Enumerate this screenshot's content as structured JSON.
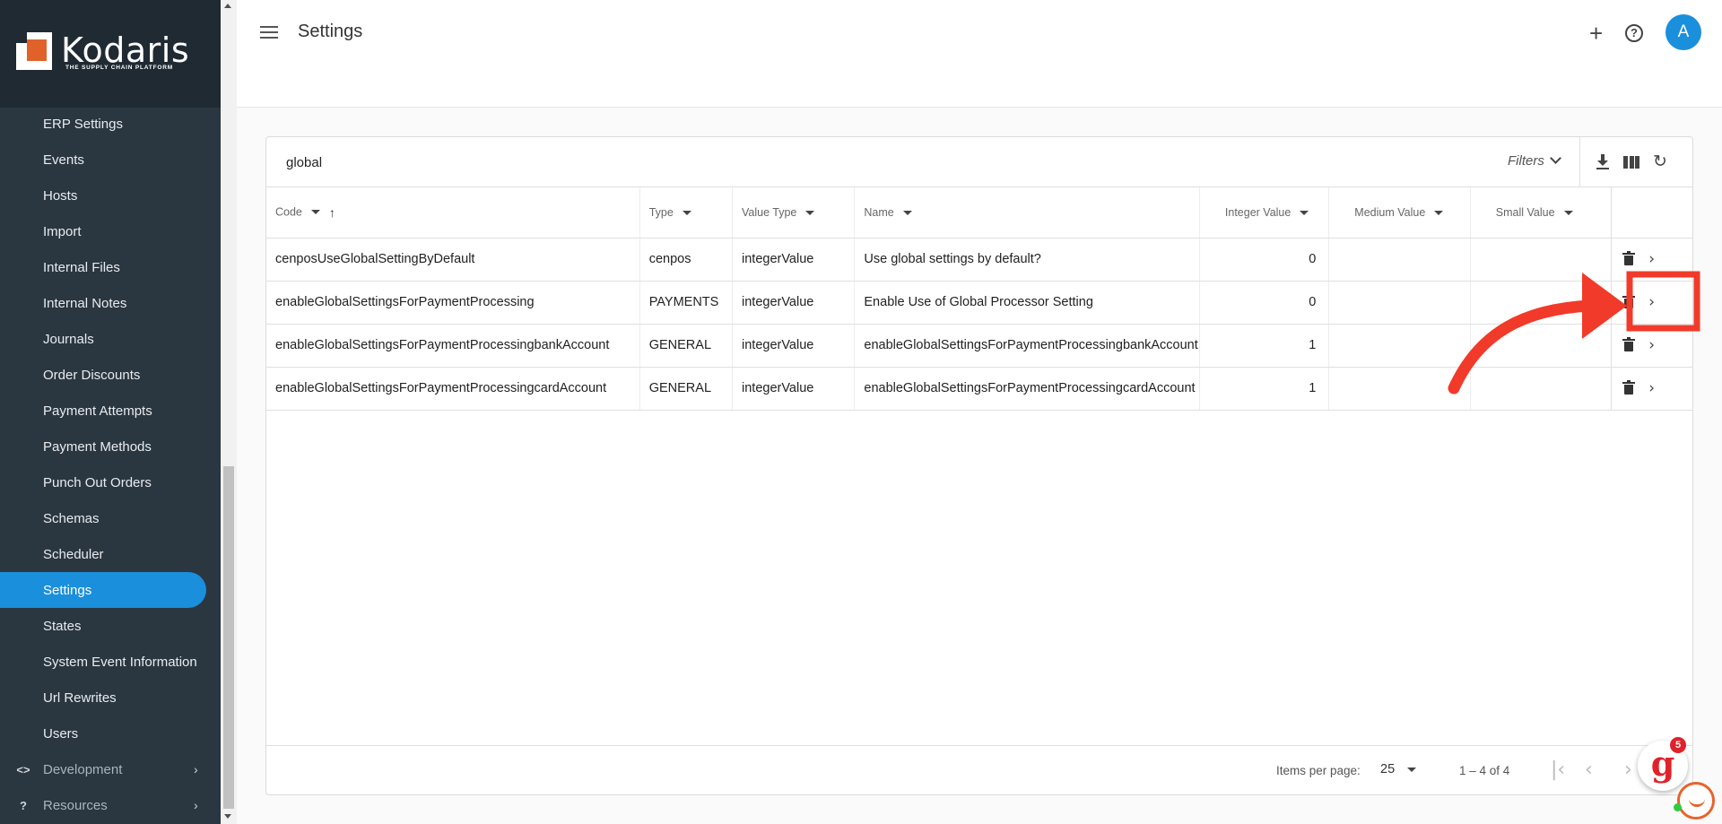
{
  "app": {
    "brand": "Kodaris",
    "tagline": "THE SUPPLY CHAIN PLATFORM"
  },
  "sidebar": {
    "items": [
      {
        "label": "ERP Settings"
      },
      {
        "label": "Events"
      },
      {
        "label": "Hosts"
      },
      {
        "label": "Import"
      },
      {
        "label": "Internal Files"
      },
      {
        "label": "Internal Notes"
      },
      {
        "label": "Journals"
      },
      {
        "label": "Order Discounts"
      },
      {
        "label": "Payment Attempts"
      },
      {
        "label": "Payment Methods"
      },
      {
        "label": "Punch Out Orders"
      },
      {
        "label": "Schemas"
      },
      {
        "label": "Scheduler"
      },
      {
        "label": "Settings"
      },
      {
        "label": "States"
      },
      {
        "label": "System Event Information"
      },
      {
        "label": "Url Rewrites"
      },
      {
        "label": "Users"
      }
    ],
    "active": "Settings",
    "groups": [
      {
        "label": "Development",
        "icon": "code-icon"
      },
      {
        "label": "Resources",
        "icon": "help-circle-icon"
      }
    ]
  },
  "header": {
    "title": "Settings",
    "avatar_initial": "A"
  },
  "toolbar": {
    "search_value": "global",
    "filters_label": "Filters"
  },
  "table": {
    "columns": [
      "Code",
      "Type",
      "Value Type",
      "Name",
      "Integer Value",
      "Medium Value",
      "Small Value"
    ],
    "rows": [
      {
        "code": "cenposUseGlobalSettingByDefault",
        "type": "cenpos",
        "value_type": "integerValue",
        "name": "Use global settings by default?",
        "integer_value": "0",
        "medium_value": "",
        "small_value": ""
      },
      {
        "code": "enableGlobalSettingsForPaymentProcessing",
        "type": "PAYMENTS",
        "value_type": "integerValue",
        "name": "Enable Use of Global Processor Setting",
        "integer_value": "0",
        "medium_value": "",
        "small_value": ""
      },
      {
        "code": "enableGlobalSettingsForPaymentProcessingbankAccount",
        "type": "GENERAL",
        "value_type": "integerValue",
        "name": "enableGlobalSettingsForPaymentProcessingbankAccount",
        "integer_value": "1",
        "medium_value": "",
        "small_value": ""
      },
      {
        "code": "enableGlobalSettingsForPaymentProcessingcardAccount",
        "type": "GENERAL",
        "value_type": "integerValue",
        "name": "enableGlobalSettingsForPaymentProcessingcardAccount",
        "integer_value": "1",
        "medium_value": "",
        "small_value": ""
      }
    ]
  },
  "pagination": {
    "items_per_page_label": "Items per page:",
    "items_per_page": "25",
    "range": "1 – 4 of 4"
  },
  "chat": {
    "badge_count": "5",
    "logo_letter": "g"
  },
  "colors": {
    "accent": "#1a8fdc",
    "sidebar_bg": "#2a3640",
    "annotation": "#f23a2a"
  }
}
